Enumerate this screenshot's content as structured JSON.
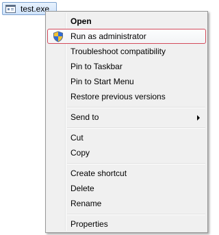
{
  "file": {
    "name": "test.exe",
    "icon": "application-window-icon"
  },
  "menu": {
    "items": [
      {
        "label": "Open",
        "bold": true
      },
      {
        "label": "Run as administrator",
        "icon": "uac-shield-icon",
        "highlighted": true
      },
      {
        "label": "Troubleshoot compatibility"
      },
      {
        "label": "Pin to Taskbar"
      },
      {
        "label": "Pin to Start Menu"
      },
      {
        "label": "Restore previous versions"
      },
      {
        "label": "Send to",
        "submenu": true,
        "submenu_icon": "submenu-arrow-icon"
      },
      {
        "label": "Cut"
      },
      {
        "label": "Copy"
      },
      {
        "label": "Create shortcut"
      },
      {
        "label": "Delete"
      },
      {
        "label": "Rename"
      },
      {
        "label": "Properties"
      }
    ]
  },
  "colors": {
    "selection_bg": "#cfe3fb",
    "selection_border": "#7da2ce",
    "menu_bg": "#f0f0f0",
    "highlight_border": "#d34a5a"
  }
}
